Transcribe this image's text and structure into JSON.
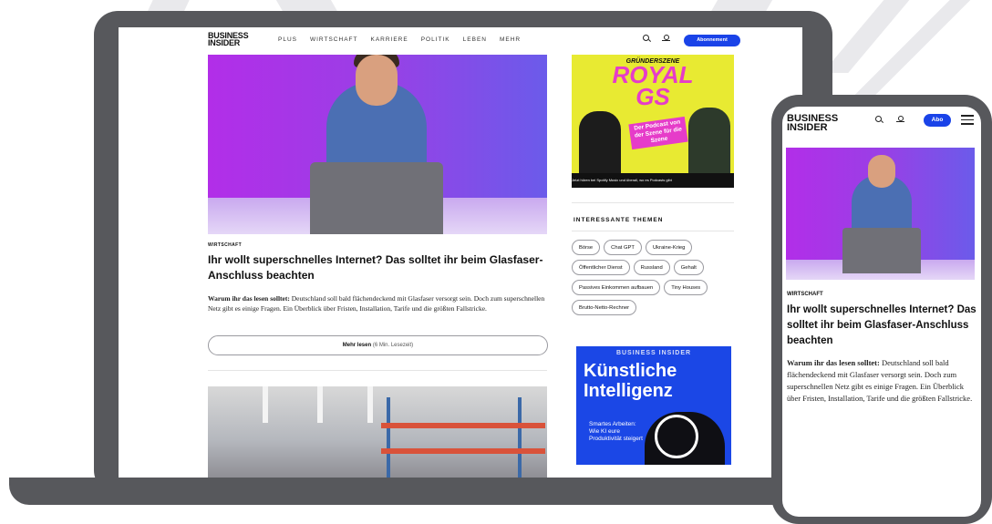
{
  "desktop": {
    "logo": "BUSINESS\nINSIDER",
    "nav": [
      "PLUS",
      "WIRTSCHAFT",
      "KARRIERE",
      "POLITIK",
      "LEBEN",
      "MEHR"
    ],
    "subscribe_label": "Abonnement",
    "article": {
      "kicker": "WIRTSCHAFT",
      "headline": "Ihr wollt superschnelles Internet? Das solltet ihr beim Glasfaser-Anschluss beachten",
      "teaser_lead": "Warum ihr das lesen solltet:",
      "teaser_body": " Deutschland soll bald flächendeckend mit Glasfaser versorgt sein. Doch zum superschnellen Netz gibt es einige Fragen. Ein Überblick über Fristen, Installation, Tarife und die größten Fallstricke.",
      "more_label": "Mehr lesen",
      "more_sub": " (6 Min. Lesezeit)"
    },
    "ad_podcast": {
      "kicker": "GRÜNDERSZENE",
      "title_line1": "ROYAL",
      "title_line2": "GS",
      "tagline": "Der Podcast von der Szene für die Szene",
      "bottom": "Jetzt hören bei   Spotify  Music   und überall, wo es Podcasts gibt"
    },
    "themes": {
      "title": "INTERESSANTE THEMEN",
      "chips": [
        "Börse",
        "Chat GPT",
        "Ukraine-Krieg",
        "Öffentlicher Dienst",
        "Russland",
        "Gehalt",
        "Passives Einkommen aufbauen",
        "Tiny Houses",
        "Brutto-Netto-Rechner"
      ]
    },
    "ad_ai": {
      "kicker": "BUSINESS INSIDER",
      "title": "Künstliche Intelligenz",
      "sub": "Smartes Arbeiten: Wie KI eure Produktivität steigert"
    }
  },
  "mobile": {
    "logo": "BUSINESS\nINSIDER",
    "subscribe_label": "Abo",
    "kicker": "WIRTSCHAFT",
    "headline": "Ihr wollt superschnelles Internet? Das solltet ihr beim Glasfaser-Anschluss beachten",
    "teaser_lead": "Warum ihr das lesen solltet:",
    "teaser_body": " Deutschland soll bald flächendeckend mit Glasfaser versorgt sein. Doch zum superschnellen Netz gibt es einige Fragen. Ein Überblick über Fristen, Installation, Tarife und die größten Fallstricke."
  },
  "colors": {
    "accent": "#1a43e8",
    "device": "#57585c",
    "podcast_bg": "#e8ea32",
    "podcast_accent": "#e63cc9"
  }
}
